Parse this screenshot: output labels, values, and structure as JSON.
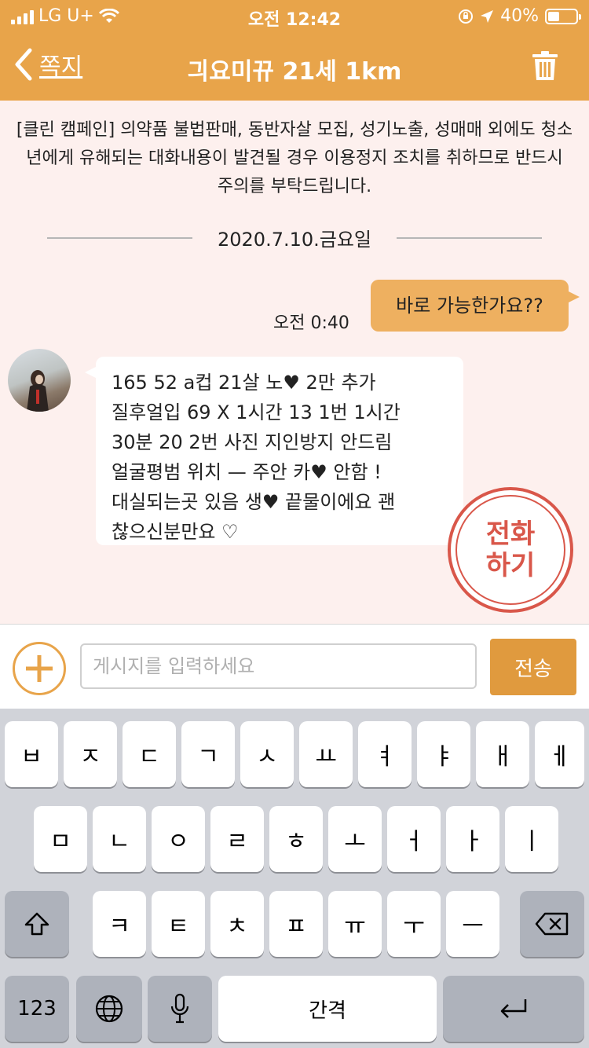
{
  "status_bar": {
    "carrier": "LG U+",
    "time": "오전 12:42",
    "battery_percent": "40%",
    "battery_level": 0.4
  },
  "nav": {
    "back_label": "쪽지",
    "title": "긔요미뀨 21세 1km"
  },
  "notice": "[클린 캠페인] 의약품 불법판매, 동반자살 모집, 성기노출, 성매매 외에도 청소년에게 유해되는 대화내용이 발견될 경우 이용정지 조치를 취하므로 반드시 주의를 부탁드립니다.",
  "date_divider": "2020.7.10.금요일",
  "messages": {
    "outgoing": {
      "text": "바로 가능한가요??",
      "time": "오전 0:40"
    },
    "incoming": {
      "lines": [
        "165 52 a컵  21살   노♥ 2만 추가",
        "질후얼입 69 X   1시간 13 1번  1시간",
        "30분 20 2번 사진 지인방지 안드림",
        "얼굴평범  위치 — 주안 카♥ 안함 !",
        "대실되는곳 있음 생♥ 끝물이에요 괜",
        "찮으신분만요 ♡"
      ]
    }
  },
  "call_button": {
    "line1": "전화",
    "line2": "하기"
  },
  "input": {
    "placeholder": "게시지를 입력하세요",
    "value": "",
    "send_label": "전송"
  },
  "keyboard": {
    "row1": [
      "ㅂ",
      "ㅈ",
      "ㄷ",
      "ㄱ",
      "ㅅ",
      "ㅛ",
      "ㅕ",
      "ㅑ",
      "ㅐ",
      "ㅔ"
    ],
    "row2": [
      "ㅁ",
      "ㄴ",
      "ㅇ",
      "ㄹ",
      "ㅎ",
      "ㅗ",
      "ㅓ",
      "ㅏ",
      "ㅣ"
    ],
    "row3": [
      "ㅋ",
      "ㅌ",
      "ㅊ",
      "ㅍ",
      "ㅠ",
      "ㅜ",
      "ㅡ"
    ],
    "numbers_label": "123",
    "space_label": "간격"
  },
  "colors": {
    "header": "#e8a44a",
    "background": "#fdf0ee",
    "outgoing_bubble": "#eeb060",
    "call_button": "#d9574a",
    "send_button": "#e09a3e",
    "keyboard_bg": "#d1d3d9"
  },
  "icons": {
    "signal": "signal-bars-icon",
    "wifi": "wifi-icon",
    "rotation_lock": "rotation-lock-icon",
    "location": "location-arrow-icon",
    "battery": "battery-icon",
    "back": "chevron-left-icon",
    "trash": "trash-icon",
    "plus": "plus-circle-icon",
    "shift": "shift-icon",
    "backspace": "backspace-icon",
    "globe": "globe-icon",
    "mic": "microphone-icon",
    "return": "return-icon"
  }
}
